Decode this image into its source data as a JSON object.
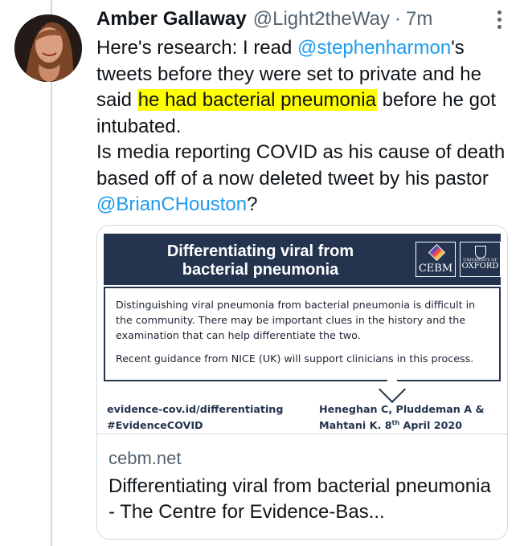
{
  "tweet": {
    "author_name": "Amber Gallaway",
    "author_handle": "@Light2theWay",
    "dot": "·",
    "time": "7m",
    "text_part1": "Here's research: I read ",
    "mention1": "@stephenharmon",
    "text_part2": "'s tweets before they were set to private and he said ",
    "highlight": "he had bacterial pneumonia",
    "text_part3": " before he got intubated.",
    "text_part4": "Is media reporting COVID as his cause of death based off of a now deleted tweet by his pastor ",
    "mention2": "@BrianCHouston",
    "text_part5": "?"
  },
  "card": {
    "image": {
      "title_line1": "Differentiating viral from",
      "title_line2": "bacterial pneumonia",
      "logo_left": "CEBM",
      "logo_right_small": "UNIVERSITY OF",
      "logo_right": "OXFORD",
      "paragraph1": "Distinguishing viral pneumonia from bacterial pneumonia is difficult in the community. There may be important clues in the history and the examination that can help differentiate the two.",
      "paragraph2": "Recent guidance from NICE (UK) will support clinicians in this process.",
      "link_text": "evidence-cov.id/differentiating",
      "hashtag": "#EvidenceCOVID",
      "authors": "Heneghan C, Pluddeman A &",
      "authors_line2": "Mahtani K.  8",
      "date_suffix": "th",
      "date": " April 2020"
    },
    "domain": "cebm.net",
    "title": "Differentiating viral from bacterial pneumonia - The Centre for Evidence-Bas..."
  },
  "icons": {
    "more": "more-options-icon",
    "avatar": "avatar",
    "cebm": "cebm-logo-icon",
    "oxford": "oxford-crest-icon"
  },
  "colors": {
    "link": "#1d9bf0",
    "highlight": "#ffff00",
    "banner": "#24344f"
  }
}
